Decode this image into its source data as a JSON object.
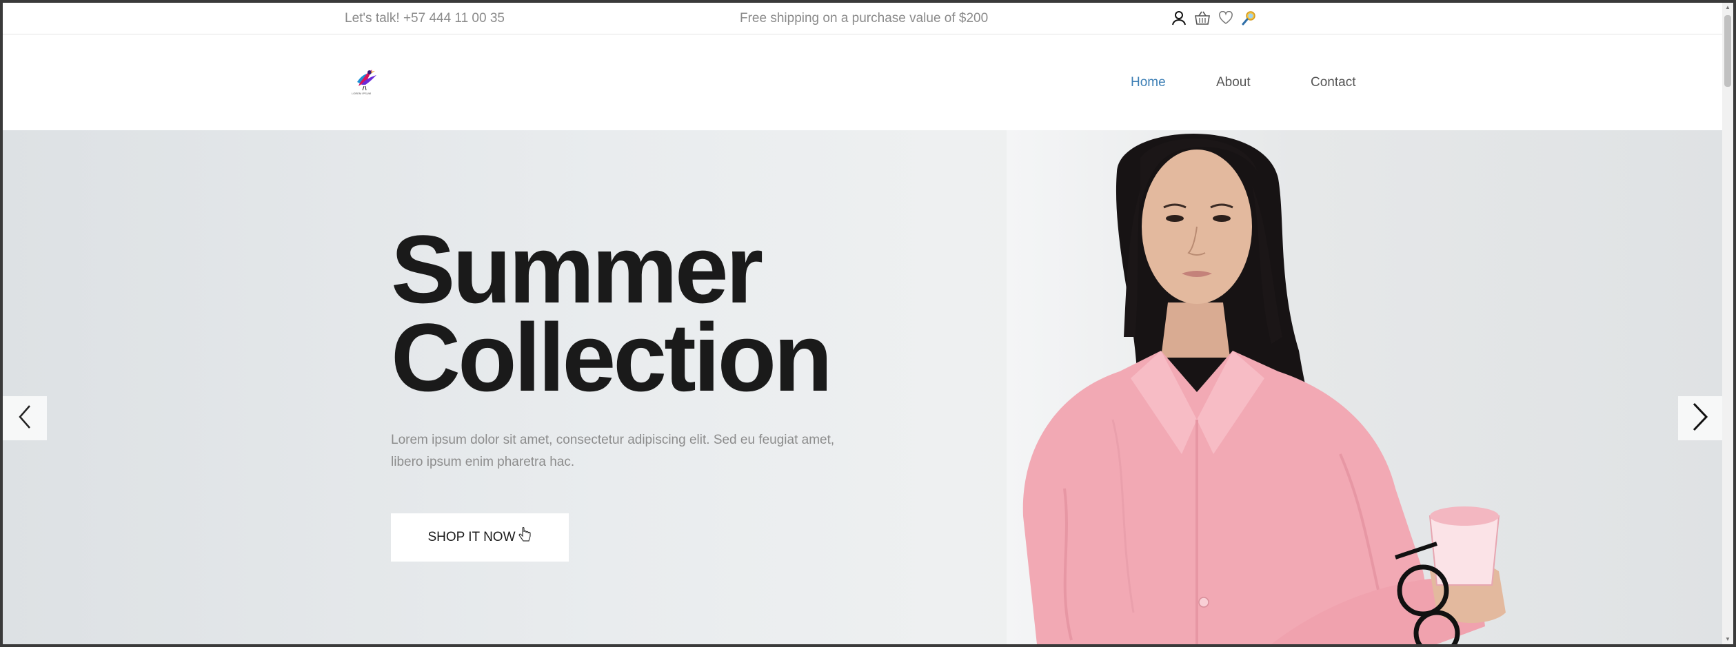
{
  "topbar": {
    "talk": "Let's talk! +57 444 11 00 35",
    "shipping": "Free shipping on a purchase value of $200",
    "icons": [
      "user-icon",
      "basket-icon",
      "heart-icon",
      "search-icon"
    ]
  },
  "header": {
    "logo_caption": "LOREM IPSUM",
    "nav": [
      {
        "label": "Home",
        "active": true
      },
      {
        "label": "About",
        "active": false
      },
      {
        "label": "Contact",
        "active": false
      }
    ]
  },
  "hero": {
    "headline_line1": "Summer",
    "headline_line2": "Collection",
    "description": "Lorem ipsum dolor sit amet, consectetur adipiscing elit. Sed eu feugiat amet, libero ipsum enim pharetra hac.",
    "cta_label": "SHOP IT NOW",
    "prev_icon": "chevron-left-icon",
    "next_icon": "chevron-right-icon"
  },
  "colors": {
    "accent": "#3d7fb5",
    "text_dark": "#1a1a1a",
    "text_muted": "#8c8c8c",
    "shirt_pink": "#f2a9b4"
  }
}
